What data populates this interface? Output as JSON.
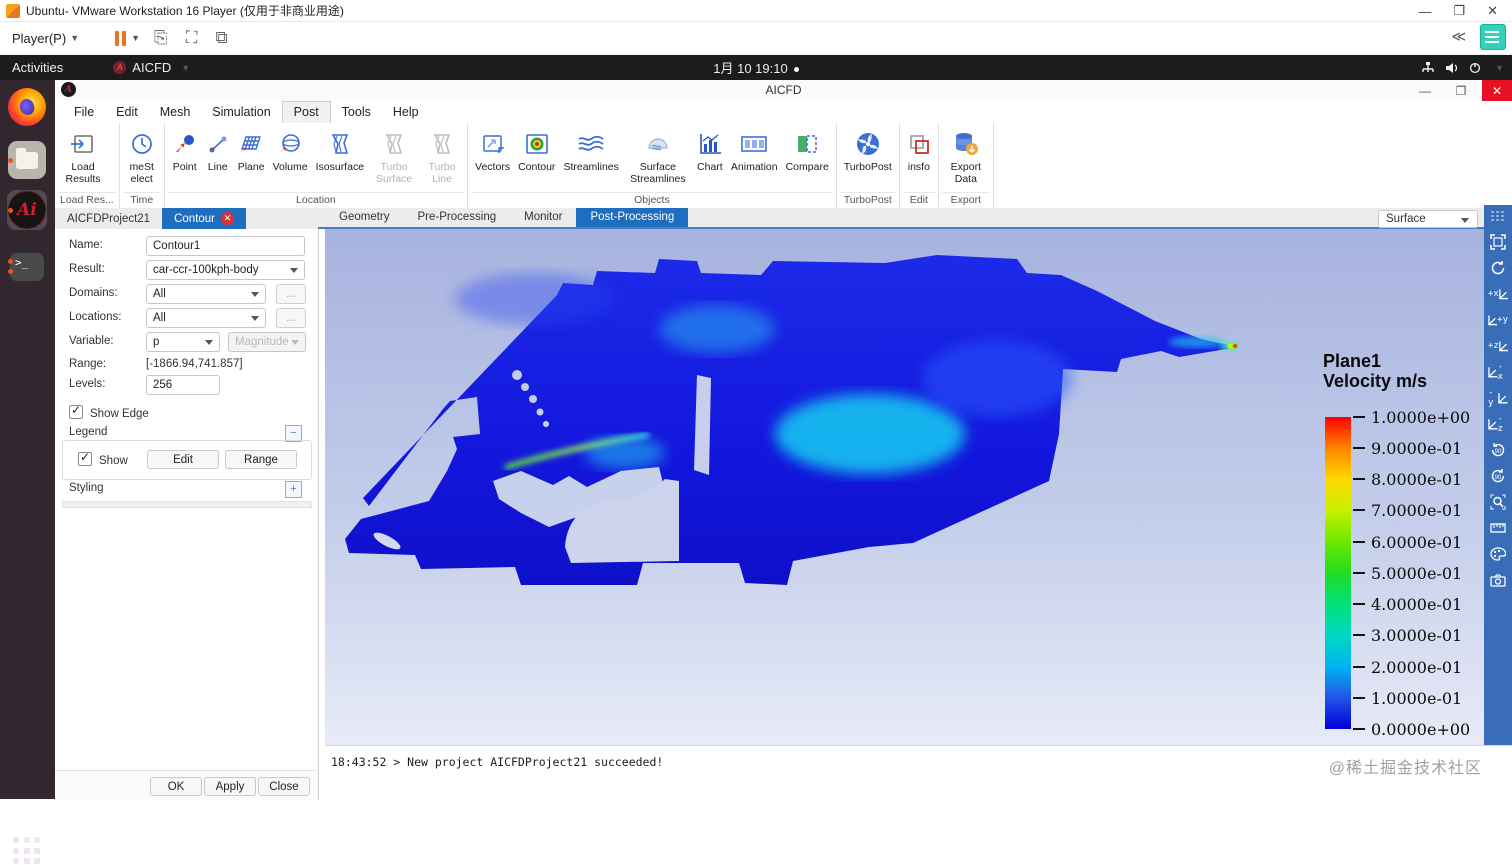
{
  "host_window": {
    "title": "Ubuntu- VMware Workstation 16 Player (仅用于非商业用途)",
    "player_menu": "Player(P)",
    "collapse_glyph": "≪",
    "min_glyph": "—",
    "max_glyph": "❐",
    "close_glyph": "✕"
  },
  "system_bar": {
    "activities": "Activities",
    "app_menu": "AICFD",
    "clock": "1月 10 19:10"
  },
  "dock": {
    "aicfd_glyph": "Ai",
    "terminal_glyph": ">_"
  },
  "app": {
    "title": "AICFD",
    "menu": [
      "File",
      "Edit",
      "Mesh",
      "Simulation",
      "Post",
      "Tools",
      "Help"
    ],
    "ribbon": {
      "groups": [
        {
          "label": "Load Res...",
          "items": [
            {
              "label": "Load Results"
            }
          ]
        },
        {
          "label": "Time",
          "items": [
            {
              "label": "meSt elect"
            }
          ]
        },
        {
          "label": "Location",
          "items": [
            {
              "label": "Point"
            },
            {
              "label": "Line"
            },
            {
              "label": "Plane"
            },
            {
              "label": "Volume"
            },
            {
              "label": "Isosurface"
            },
            {
              "label": "Turbo Surface"
            },
            {
              "label": "Turbo Line"
            }
          ]
        },
        {
          "label": "Objects",
          "items": [
            {
              "label": "Vectors"
            },
            {
              "label": "Contour"
            },
            {
              "label": "Streamlines"
            },
            {
              "label": "Surface Streamlines"
            },
            {
              "label": "Chart"
            },
            {
              "label": "Animation"
            },
            {
              "label": "Compare"
            }
          ]
        },
        {
          "label": "TurboPost",
          "items": [
            {
              "label": "TurboPost"
            }
          ]
        },
        {
          "label": "Edit",
          "items": [
            {
              "label": "insfo"
            }
          ]
        },
        {
          "label": "Export",
          "items": [
            {
              "label": "Export Data"
            }
          ]
        }
      ]
    }
  },
  "panel": {
    "tabs": {
      "project": "AICFDProject21",
      "active": "Contour"
    },
    "form": {
      "name_label": "Name:",
      "name_value": "Contour1",
      "result_label": "Result:",
      "result_value": "car-ccr-100kph-body",
      "domains_label": "Domains:",
      "domains_value": "All",
      "locations_label": "Locations:",
      "locations_value": "All",
      "variable_label": "Variable:",
      "variable_value": "p",
      "variable_component": "Magnitude",
      "range_label": "Range:",
      "range_value": "[-1866.94,741.857]",
      "levels_label": "Levels:",
      "levels_value": "256",
      "ellipsis": "..."
    },
    "show_edge_label": "Show Edge",
    "legend_section": "Legend",
    "legend_show_label": "Show",
    "legend_edit": "Edit",
    "legend_range": "Range",
    "styling_section": "Styling",
    "ok": "OK",
    "apply": "Apply",
    "close": "Close"
  },
  "workspace": {
    "tabs": [
      "Geometry",
      "Pre-Processing",
      "Monitor",
      "Post-Processing"
    ],
    "active_tab": "Post-Processing",
    "surface_selector": "Surface",
    "legend": {
      "title_line1": "Plane1",
      "title_line2": "Velocity m/s",
      "ticks": [
        "1.0000e+00",
        "9.0000e-01",
        "8.0000e-01",
        "7.0000e-01",
        "6.0000e-01",
        "5.0000e-01",
        "4.0000e-01",
        "3.0000e-01",
        "2.0000e-01",
        "1.0000e-01",
        "0.0000e+00"
      ],
      "colorbar_stops": [
        "#ff0000",
        "#ff8400",
        "#ffd800",
        "#c8f000",
        "#6ce800",
        "#22dd22",
        "#00e07a",
        "#00d8c0",
        "#00b4f0",
        "#2255e8",
        "#0000d8"
      ]
    },
    "log": "18:43:52 > New project AICFDProject21 succeeded!",
    "watermark": "@稀土掘金技术社区"
  },
  "icons": {
    "right_toolbar": [
      "list-options",
      "fit-view",
      "rotate",
      "view-plus-x",
      "view-plus-y",
      "view-plus-z",
      "view-minus-x",
      "view-minus-y",
      "view-minus-z",
      "rotate-90-ccw",
      "rotate-90-cw",
      "zoom-area",
      "measure",
      "palette",
      "snapshot"
    ]
  },
  "colors": {
    "accent_blue": "#2272c3",
    "sidebar_blue": "#3a6db8",
    "contour_base_blue": "#1317dd",
    "app_close_red": "#e81123",
    "tab_close_red": "#e03131",
    "pause_orange": "#e87722"
  }
}
